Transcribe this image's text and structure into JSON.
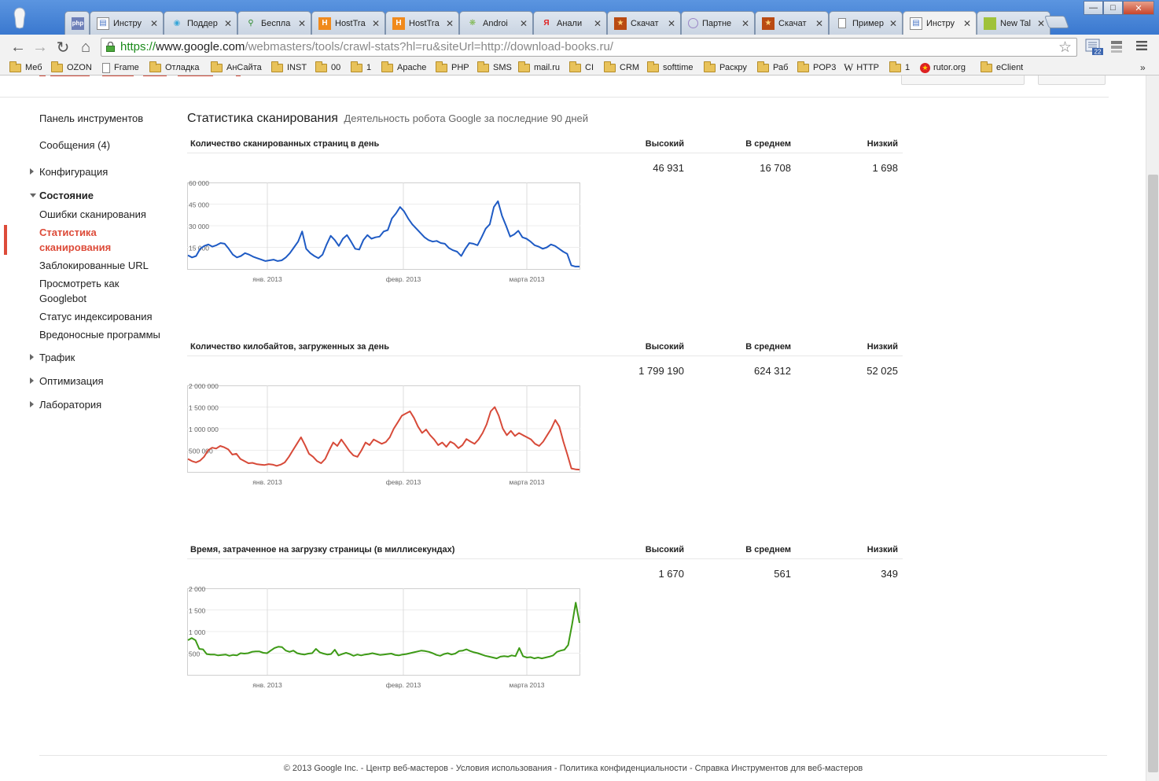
{
  "browser": {
    "tabs": [
      {
        "label": "php",
        "icon": "php-icon"
      },
      {
        "label": "Инстру",
        "icon": "webmaster-icon"
      },
      {
        "label": "Поддер",
        "icon": "support-icon"
      },
      {
        "label": "Беспла",
        "icon": "search-magnifier-icon"
      },
      {
        "label": "HostTra",
        "icon": "hosttracker-icon"
      },
      {
        "label": "HostTra",
        "icon": "hosttracker-icon"
      },
      {
        "label": "Androi",
        "icon": "android-icon"
      },
      {
        "label": "Анали",
        "icon": "yandex-icon"
      },
      {
        "label": "Скачат",
        "icon": "download-books-icon"
      },
      {
        "label": "Партне",
        "icon": "partner-icon"
      },
      {
        "label": "Скачат",
        "icon": "download-books-icon"
      },
      {
        "label": "Пример",
        "icon": "page-icon"
      },
      {
        "label": "Инстру",
        "icon": "webmaster-icon"
      },
      {
        "label": "New Tal",
        "icon": "new-tab-icon"
      }
    ],
    "active_tab_index": 12,
    "address": {
      "scheme": "https://",
      "host": "www.google.com",
      "path": "/webmasters/tools/crawl-stats?hl=ru&siteUrl=http://download-books.ru/"
    },
    "extension_badge": "22",
    "bookmarks": [
      {
        "label": "Меб",
        "icon": "folder-icon"
      },
      {
        "label": "OZON",
        "icon": "folder-icon"
      },
      {
        "label": "Frame",
        "icon": "page-icon"
      },
      {
        "label": "Отладка",
        "icon": "folder-icon"
      },
      {
        "label": "АнСайта",
        "icon": "folder-icon"
      },
      {
        "label": "INST",
        "icon": "folder-icon"
      },
      {
        "label": "00",
        "icon": "folder-icon"
      },
      {
        "label": "1",
        "icon": "folder-icon"
      },
      {
        "label": "Apache",
        "icon": "folder-icon"
      },
      {
        "label": "PHP",
        "icon": "folder-icon"
      },
      {
        "label": "SMS",
        "icon": "folder-icon"
      },
      {
        "label": "mail.ru",
        "icon": "folder-icon"
      },
      {
        "label": "CI",
        "icon": "folder-icon"
      },
      {
        "label": "CRM",
        "icon": "folder-icon"
      },
      {
        "label": "softtime",
        "icon": "folder-icon"
      },
      {
        "label": "Раскру",
        "icon": "folder-icon"
      },
      {
        "label": "Раб",
        "icon": "folder-icon"
      },
      {
        "label": "POP3",
        "icon": "folder-icon"
      },
      {
        "label": "HTTP",
        "icon": "wikipedia-icon"
      },
      {
        "label": "1",
        "icon": "folder-icon"
      },
      {
        "label": "rutor.org",
        "icon": "rutor-icon"
      },
      {
        "label": "eClient",
        "icon": "folder-icon"
      }
    ],
    "bookmarks_overflow": "»"
  },
  "sidebar": {
    "items": [
      {
        "label": "Панель инструментов"
      },
      {
        "label": "Сообщения (4)"
      },
      {
        "label": "Конфигурация"
      },
      {
        "label": "Состояние"
      },
      {
        "label": "Ошибки сканирования"
      },
      {
        "label": "Статистика"
      },
      {
        "label": "сканирования"
      },
      {
        "label": "Заблокированные URL"
      },
      {
        "label": "Просмотреть как"
      },
      {
        "label": "Googlebot"
      },
      {
        "label": "Статус индексирования"
      },
      {
        "label": "Вредоносные программы"
      },
      {
        "label": "Трафик"
      },
      {
        "label": "Оптимизация"
      },
      {
        "label": "Лаборатория"
      }
    ]
  },
  "main": {
    "title": "Статистика сканирования",
    "subtitle": "Деятельность робота Google за последние 90 дней",
    "column_headers": {
      "high": "Высокий",
      "avg": "В среднем",
      "low": "Низкий"
    },
    "sections": [
      {
        "title": "Количество сканированных страниц в день",
        "high": "46 931",
        "avg": "16 708",
        "low": "1 698"
      },
      {
        "title": "Количество килобайтов, загруженных за день",
        "high": "1 799 190",
        "avg": "624 312",
        "low": "52 025"
      },
      {
        "title": "Время, затраченное на загрузку страницы (в миллисекундах)",
        "high": "1 670",
        "avg": "561",
        "low": "349"
      }
    ]
  },
  "chart_data": [
    {
      "type": "line",
      "color": "#1f5bc4",
      "ylim": [
        0,
        60000
      ],
      "yticks": [
        "60 000",
        "45 000",
        "30 000",
        "15 000"
      ],
      "xticks": [
        "янв. 2013",
        "февр. 2013",
        "марта 2013"
      ],
      "series": [
        {
          "values": [
            9500,
            8000,
            9000,
            14000,
            16000,
            17000,
            15500,
            16500,
            18000,
            17500,
            14000,
            10000,
            8000,
            9000,
            11000,
            10000,
            8500,
            7500,
            6500,
            5500,
            6000,
            6500,
            5500,
            6000,
            8000,
            11000,
            15000,
            19000,
            26000,
            14000,
            11000,
            9000,
            7500,
            10000,
            17000,
            23000,
            20000,
            16000,
            21000,
            23500,
            19000,
            14000,
            13500,
            20000,
            23500,
            21000,
            22000,
            22500,
            26000,
            27000,
            35000,
            38500,
            43000,
            40000,
            35000,
            31000,
            28000,
            25000,
            22000,
            20000,
            19000,
            19500,
            18000,
            17500,
            14500,
            13000,
            12000,
            9000,
            14000,
            18000,
            17500,
            16500,
            22000,
            28000,
            31000,
            43000,
            47000,
            37000,
            30000,
            22500,
            24000,
            26500,
            22000,
            21000,
            19000,
            16500,
            15500,
            14000,
            15000,
            17000,
            16000,
            14000,
            12000,
            10500,
            2500,
            1700,
            1700
          ]
        }
      ]
    },
    {
      "type": "line",
      "color": "#d74a39",
      "ylim": [
        0,
        2000000
      ],
      "yticks": [
        "2 000 000",
        "1 500 000",
        "1 000 000",
        "500 000"
      ],
      "xticks": [
        "янв. 2013",
        "февр. 2013",
        "марта 2013"
      ],
      "series": [
        {
          "values": [
            300000,
            250000,
            220000,
            260000,
            350000,
            500000,
            560000,
            540000,
            600000,
            570000,
            520000,
            400000,
            420000,
            300000,
            250000,
            200000,
            210000,
            180000,
            170000,
            160000,
            180000,
            170000,
            140000,
            170000,
            220000,
            350000,
            500000,
            650000,
            800000,
            620000,
            420000,
            350000,
            250000,
            200000,
            300000,
            500000,
            680000,
            600000,
            750000,
            620000,
            480000,
            380000,
            350000,
            500000,
            680000,
            620000,
            750000,
            700000,
            650000,
            690000,
            800000,
            1000000,
            1150000,
            1300000,
            1350000,
            1400000,
            1250000,
            1050000,
            900000,
            980000,
            850000,
            750000,
            620000,
            680000,
            580000,
            700000,
            650000,
            550000,
            620000,
            760000,
            700000,
            650000,
            750000,
            900000,
            1100000,
            1400000,
            1500000,
            1300000,
            1000000,
            850000,
            950000,
            830000,
            900000,
            850000,
            800000,
            750000,
            650000,
            600000,
            700000,
            850000,
            1000000,
            1200000,
            1050000,
            700000,
            400000,
            80000,
            60000,
            52000
          ]
        }
      ]
    },
    {
      "type": "line",
      "color": "#3d9a16",
      "ylim": [
        0,
        2000
      ],
      "yticks": [
        "2 000",
        "1 500",
        "1 000",
        "500"
      ],
      "xticks": [
        "янв. 2013",
        "февр. 2013",
        "марта 2013"
      ],
      "series": [
        {
          "values": [
            800,
            850,
            800,
            600,
            590,
            480,
            470,
            470,
            450,
            460,
            470,
            440,
            460,
            450,
            500,
            490,
            500,
            530,
            540,
            540,
            510,
            500,
            560,
            620,
            650,
            640,
            560,
            530,
            560,
            500,
            480,
            470,
            490,
            500,
            600,
            520,
            490,
            470,
            480,
            580,
            450,
            480,
            510,
            480,
            440,
            470,
            450,
            470,
            480,
            500,
            480,
            460,
            470,
            480,
            490,
            460,
            450,
            470,
            480,
            500,
            520,
            540,
            560,
            550,
            530,
            500,
            460,
            440,
            480,
            500,
            470,
            490,
            550,
            560,
            590,
            550,
            520,
            500,
            470,
            440,
            420,
            400,
            380,
            420,
            430,
            420,
            450,
            430,
            620,
            430,
            400,
            410,
            380,
            400,
            380,
            400,
            420,
            450,
            530,
            560,
            580,
            690,
            1150,
            1670,
            1200
          ]
        }
      ]
    }
  ],
  "footer": {
    "copyright": "© 2013 Google Inc. - ",
    "links": [
      {
        "label": "Центр веб-мастеров"
      },
      {
        "label": " - "
      },
      {
        "label": "Условия использования"
      },
      {
        "label": " - "
      },
      {
        "label": "Политика конфиденциальности"
      },
      {
        "label": " - "
      },
      {
        "label": "Справка Инструментов для веб-мастеров"
      }
    ]
  }
}
